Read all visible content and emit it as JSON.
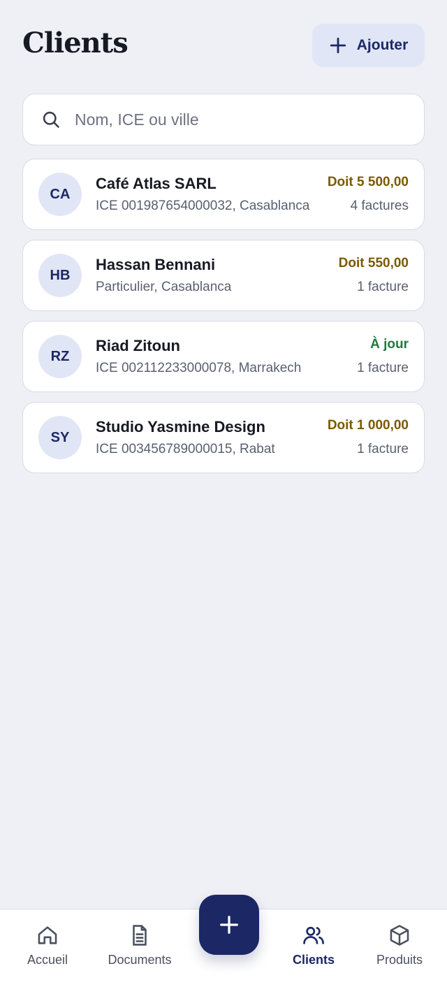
{
  "header": {
    "title": "Clients",
    "add_label": "Ajouter"
  },
  "search": {
    "placeholder": "Nom, ICE ou ville"
  },
  "clients": [
    {
      "initials": "CA",
      "name": "Café Atlas SARL",
      "sub": "ICE 001987654000032, Casablanca",
      "balance": "Doit 5 500,00",
      "status": "due",
      "count": "4 factures"
    },
    {
      "initials": "HB",
      "name": "Hassan Bennani",
      "sub": "Particulier, Casablanca",
      "balance": "Doit 550,00",
      "status": "due",
      "count": "1 facture"
    },
    {
      "initials": "RZ",
      "name": "Riad Zitoun",
      "sub": "ICE 002112233000078, Marrakech",
      "balance": "À jour",
      "status": "ok",
      "count": "1 facture"
    },
    {
      "initials": "SY",
      "name": "Studio Yasmine Design",
      "sub": "ICE 003456789000015, Rabat",
      "balance": "Doit 1 000,00",
      "status": "due",
      "count": "1 facture"
    }
  ],
  "nav": [
    {
      "label": "Accueil",
      "icon": "home-icon",
      "active": false
    },
    {
      "label": "Documents",
      "icon": "document-icon",
      "active": false
    },
    {
      "label": "Clients",
      "icon": "users-icon",
      "active": true
    },
    {
      "label": "Produits",
      "icon": "box-icon",
      "active": false
    }
  ],
  "colors": {
    "accent": "#1c2766",
    "accent_soft": "#e1e6f6",
    "due": "#7a5a00",
    "ok": "#217a3c",
    "background": "#eef0f5"
  }
}
